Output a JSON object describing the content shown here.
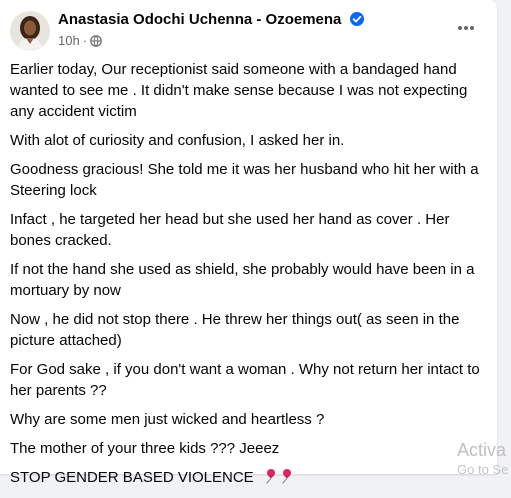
{
  "post": {
    "author_name": "Anastasia Odochi Uchenna - Ozoemena",
    "timestamp": "10h",
    "separator": "·",
    "privacy_icon": "globe-icon",
    "more_icon": "more-options-icon",
    "verified_icon": "verified-badge-icon",
    "paragraphs": [
      "Earlier today, Our receptionist said someone with a bandaged hand wanted to see me . It didn't make sense because I was not expecting any accident victim",
      "With alot of  curiosity and confusion, I asked her in.",
      "Goodness gracious! She told me it was her husband who hit her with a Steering lock",
      "Infact , he targeted her head but she used her hand as cover . Her bones cracked.",
      "If not the hand she used as shield, she probably would have been in a mortuary by now",
      "Now , he did not stop there . He threw her things out( as seen in the picture attached)",
      "For God sake , if you don't want a woman . Why not return her intact to her parents ??",
      "Why are some men just wicked and heartless ?",
      "The mother of your three kids ??? Jeeez"
    ],
    "closing_text": "STOP GENDER BASED VIOLENCE",
    "closing_emoji": "pushpin-icon"
  },
  "watermark": {
    "line1": "Activa",
    "line2": "Go to Se"
  },
  "colors": {
    "background": "#f0f2f5",
    "text_primary": "#050505",
    "text_secondary": "#65676b",
    "verified_blue": "#0866ff",
    "pin_red": "#e0245e"
  }
}
